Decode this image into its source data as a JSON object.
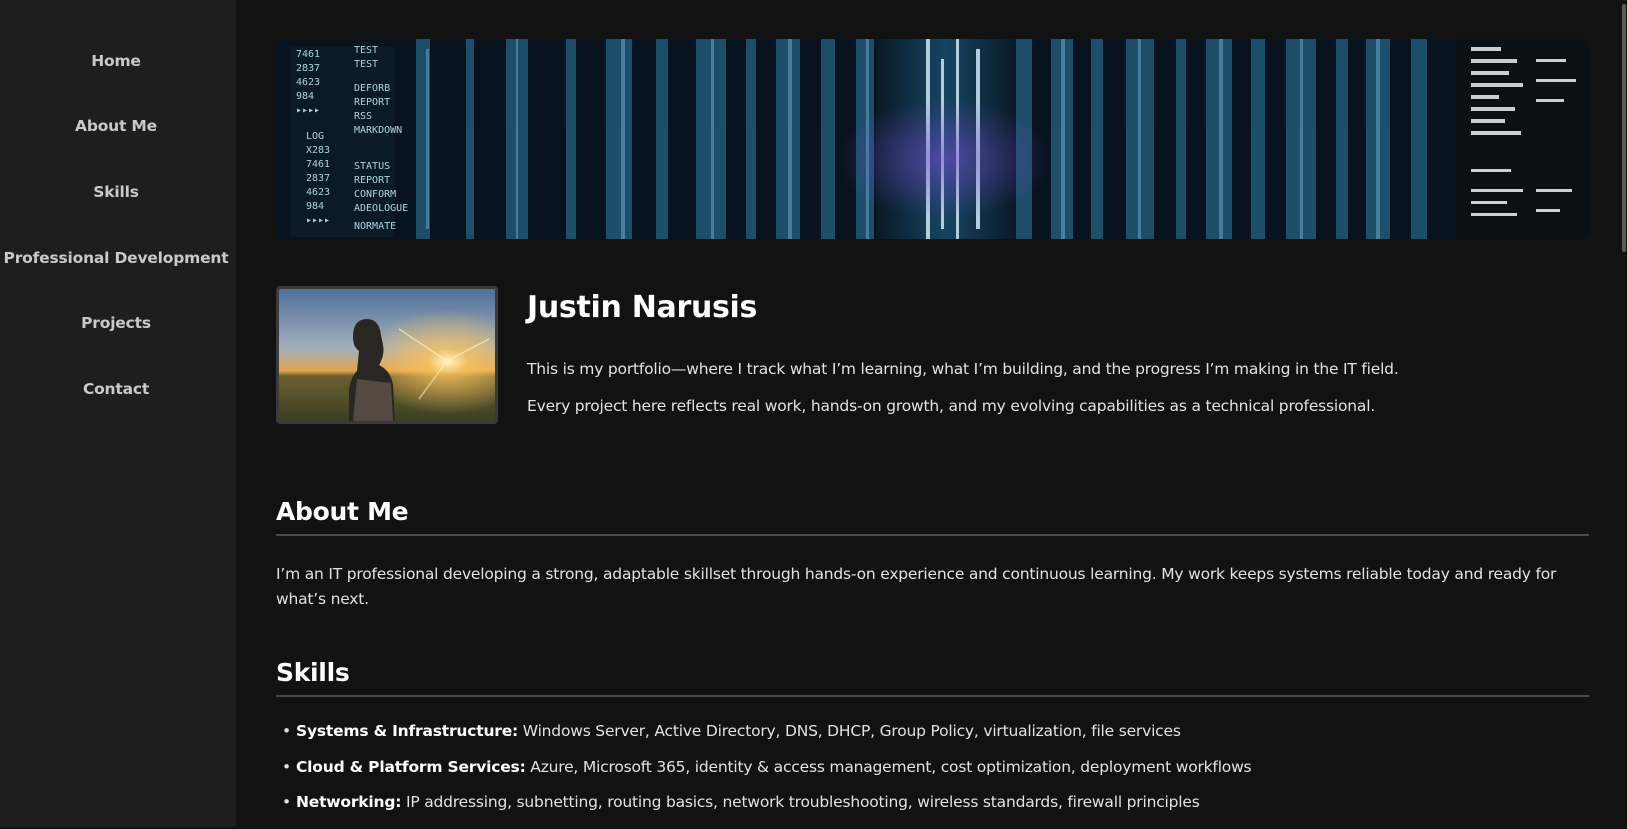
{
  "nav": {
    "items": [
      {
        "label": "Home"
      },
      {
        "label": "About Me"
      },
      {
        "label": "Skills"
      },
      {
        "label": "Professional Development"
      },
      {
        "label": "Projects"
      },
      {
        "label": "Contact"
      }
    ]
  },
  "hero": {
    "name": "Justin Narusis",
    "intro_1": "This is my portfolio—where I track what I’m learning, what I’m building, and the progress I’m making in the IT field.",
    "intro_2": "Every project here reflects real work, hands-on growth, and my evolving capabilities as a technical professional."
  },
  "about": {
    "title": "About Me",
    "text": "I’m an IT professional developing a strong, adaptable skillset through hands-on experience and continuous learning. My work keeps systems reliable today and ready for what’s next."
  },
  "skills": {
    "title": "Skills",
    "items": [
      {
        "label": "Systems & Infrastructure:",
        "text": " Windows Server, Active Directory, DNS, DHCP, Group Policy, virtualization, file services"
      },
      {
        "label": "Cloud & Platform Services:",
        "text": " Azure, Microsoft 365, identity & access management, cost optimization, deployment workflows"
      },
      {
        "label": "Networking:",
        "text": " IP addressing, subnetting, routing basics, network troubleshooting, wireless standards, firewall principles"
      }
    ]
  },
  "banner_art": {
    "left_panel_text": [
      "7461",
      "2837",
      "4623",
      "984",
      "▸▸▸▸",
      "LOG",
      "X283",
      "7461",
      "2837",
      "4623",
      "984",
      "▸▸▸▸"
    ],
    "right_panel_text": [
      "TEST",
      "TEST",
      "DEFORB",
      "REPORT",
      "RSS",
      "MARKDOWN",
      "STATUS",
      "REPORT",
      "CONFORM",
      "ADEOLOGUE",
      "NORMATE"
    ]
  },
  "colors": {
    "background": "#121212",
    "sidebar": "#1e1e1e",
    "accent_cyan": "#5fb8e6"
  }
}
